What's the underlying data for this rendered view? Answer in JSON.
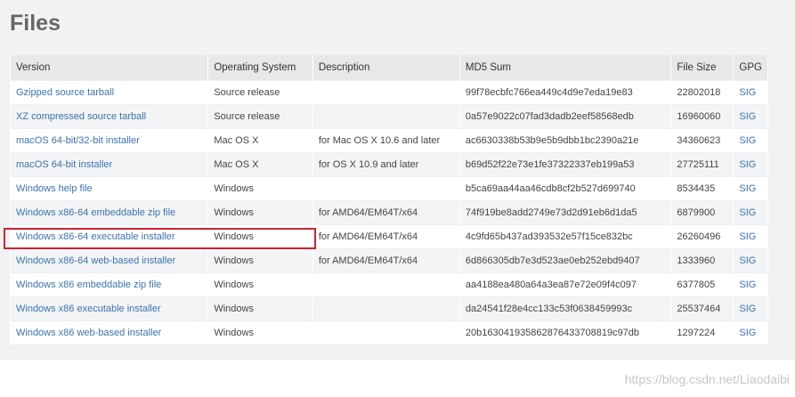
{
  "title": "Files",
  "columns": [
    "Version",
    "Operating System",
    "Description",
    "MD5 Sum",
    "File Size",
    "GPG"
  ],
  "rows": [
    {
      "version": "Gzipped source tarball",
      "os": "Source release",
      "description": "",
      "md5": "99f78ecbfc766ea449c4d9e7eda19e83",
      "size": "22802018",
      "gpg": "SIG"
    },
    {
      "version": "XZ compressed source tarball",
      "os": "Source release",
      "description": "",
      "md5": "0a57e9022c07fad3dadb2eef58568edb",
      "size": "16960060",
      "gpg": "SIG"
    },
    {
      "version": "macOS 64-bit/32-bit installer",
      "os": "Mac OS X",
      "description": "for Mac OS X 10.6 and later",
      "md5": "ac6630338b53b9e5b9dbb1bc2390a21e",
      "size": "34360623",
      "gpg": "SIG"
    },
    {
      "version": "macOS 64-bit installer",
      "os": "Mac OS X",
      "description": "for OS X 10.9 and later",
      "md5": "b69d52f22e73e1fe37322337eb199a53",
      "size": "27725111",
      "gpg": "SIG"
    },
    {
      "version": "Windows help file",
      "os": "Windows",
      "description": "",
      "md5": "b5ca69aa44aa46cdb8cf2b527d699740",
      "size": "8534435",
      "gpg": "SIG"
    },
    {
      "version": "Windows x86-64 embeddable zip file",
      "os": "Windows",
      "description": "for AMD64/EM64T/x64",
      "md5": "74f919be8add2749e73d2d91eb6d1da5",
      "size": "6879900",
      "gpg": "SIG"
    },
    {
      "version": "Windows x86-64 executable installer",
      "os": "Windows",
      "description": "for AMD64/EM64T/x64",
      "md5": "4c9fd65b437ad393532e57f15ce832bc",
      "size": "26260496",
      "gpg": "SIG"
    },
    {
      "version": "Windows x86-64 web-based installer",
      "os": "Windows",
      "description": "for AMD64/EM64T/x64",
      "md5": "6d866305db7e3d523ae0eb252ebd9407",
      "size": "1333960",
      "gpg": "SIG"
    },
    {
      "version": "Windows x86 embeddable zip file",
      "os": "Windows",
      "description": "",
      "md5": "aa4188ea480a64a3ea87e72e09f4c097",
      "size": "6377805",
      "gpg": "SIG"
    },
    {
      "version": "Windows x86 executable installer",
      "os": "Windows",
      "description": "",
      "md5": "da24541f28e4cc133c53f0638459993c",
      "size": "25537464",
      "gpg": "SIG"
    },
    {
      "version": "Windows x86 web-based installer",
      "os": "Windows",
      "description": "",
      "md5": "20b163041935862876433708819c97db",
      "size": "1297224",
      "gpg": "SIG"
    }
  ],
  "highlighted_row": "Windows x86-64 executable installer",
  "watermark": "https://blog.csdn.net/Liaodaibi",
  "colors": {
    "link": "#3b73ae",
    "highlight_border": "#cc2233",
    "header_bg": "#e6e8ea",
    "title": "#666666"
  }
}
